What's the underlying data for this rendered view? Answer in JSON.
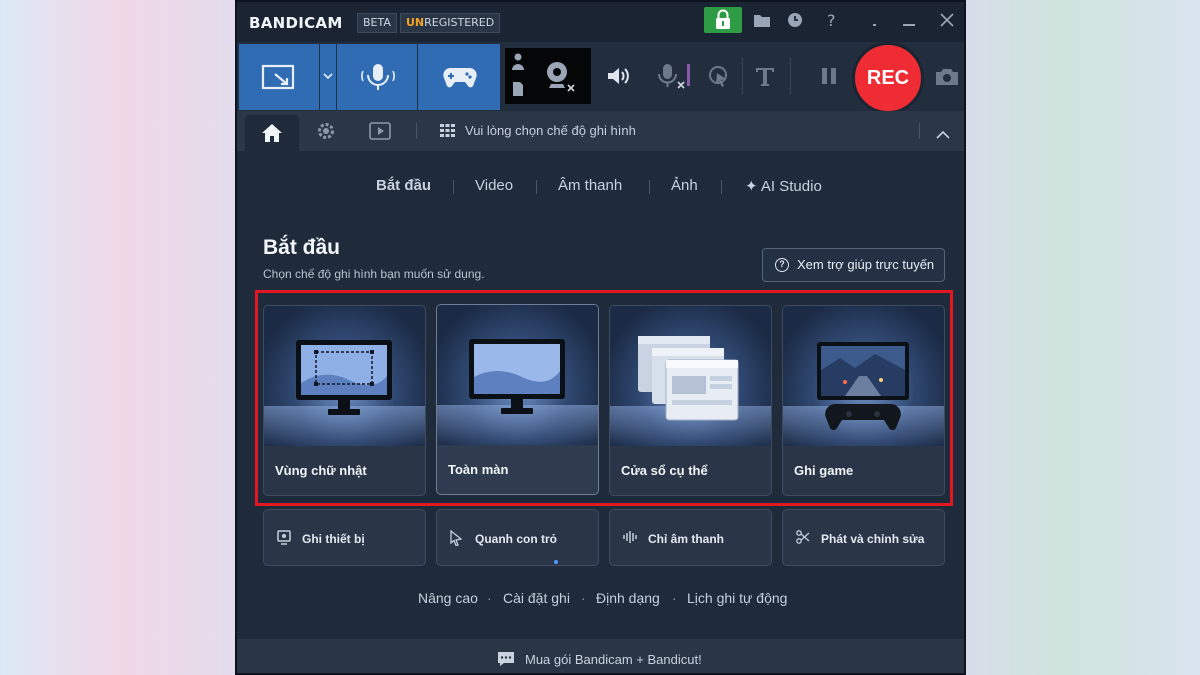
{
  "titlebar": {
    "logo": "BANDICAM",
    "beta": "BETA",
    "unreg_prefix": "UN",
    "unreg_rest": "REGISTERED"
  },
  "toolbar": {
    "rec_label": "REC"
  },
  "tabrow": {
    "mode_hint": "Vui lòng chọn chế độ ghi hình"
  },
  "nav": {
    "items": [
      "Bắt đầu",
      "Video",
      "Âm thanh",
      "Ảnh",
      "✦ AI Studio"
    ]
  },
  "main": {
    "title": "Bắt đầu",
    "subtitle": "Chọn chế độ ghi hình bạn muốn sử dụng.",
    "help_button": "Xem trợ giúp trực tuyến"
  },
  "modes": [
    {
      "label": "Vùng chữ nhật"
    },
    {
      "label": "Toàn màn"
    },
    {
      "label": "Cửa sổ cụ thể"
    },
    {
      "label": "Ghi game"
    }
  ],
  "secondary": [
    {
      "label": "Ghi thiết bị"
    },
    {
      "label": "Quanh con trỏ"
    },
    {
      "label": "Chỉ âm thanh"
    },
    {
      "label": "Phát và chỉnh sửa"
    }
  ],
  "links": [
    "Nâng cao",
    "Cài đặt ghi",
    "Định dạng",
    "Lịch ghi tự động"
  ],
  "footer": {
    "text": "Mua gói Bandicam + Bandicut!"
  },
  "colors": {
    "accent": "#2f6cb3",
    "rec": "#ef2b33",
    "lock": "#2e9b45",
    "highlight": "#e3171f",
    "active_tab": "#5da8ff"
  }
}
